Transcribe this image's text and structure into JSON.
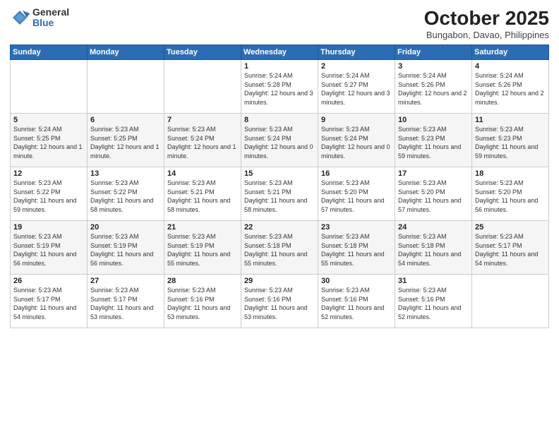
{
  "logo": {
    "general": "General",
    "blue": "Blue"
  },
  "header": {
    "month": "October 2025",
    "location": "Bungabon, Davao, Philippines"
  },
  "weekdays": [
    "Sunday",
    "Monday",
    "Tuesday",
    "Wednesday",
    "Thursday",
    "Friday",
    "Saturday"
  ],
  "weeks": [
    [
      {
        "day": "",
        "sunrise": "",
        "sunset": "",
        "daylight": ""
      },
      {
        "day": "",
        "sunrise": "",
        "sunset": "",
        "daylight": ""
      },
      {
        "day": "",
        "sunrise": "",
        "sunset": "",
        "daylight": ""
      },
      {
        "day": "1",
        "sunrise": "Sunrise: 5:24 AM",
        "sunset": "Sunset: 5:28 PM",
        "daylight": "Daylight: 12 hours and 3 minutes."
      },
      {
        "day": "2",
        "sunrise": "Sunrise: 5:24 AM",
        "sunset": "Sunset: 5:27 PM",
        "daylight": "Daylight: 12 hours and 3 minutes."
      },
      {
        "day": "3",
        "sunrise": "Sunrise: 5:24 AM",
        "sunset": "Sunset: 5:26 PM",
        "daylight": "Daylight: 12 hours and 2 minutes."
      },
      {
        "day": "4",
        "sunrise": "Sunrise: 5:24 AM",
        "sunset": "Sunset: 5:26 PM",
        "daylight": "Daylight: 12 hours and 2 minutes."
      }
    ],
    [
      {
        "day": "5",
        "sunrise": "Sunrise: 5:24 AM",
        "sunset": "Sunset: 5:25 PM",
        "daylight": "Daylight: 12 hours and 1 minute."
      },
      {
        "day": "6",
        "sunrise": "Sunrise: 5:23 AM",
        "sunset": "Sunset: 5:25 PM",
        "daylight": "Daylight: 12 hours and 1 minute."
      },
      {
        "day": "7",
        "sunrise": "Sunrise: 5:23 AM",
        "sunset": "Sunset: 5:24 PM",
        "daylight": "Daylight: 12 hours and 1 minute."
      },
      {
        "day": "8",
        "sunrise": "Sunrise: 5:23 AM",
        "sunset": "Sunset: 5:24 PM",
        "daylight": "Daylight: 12 hours and 0 minutes."
      },
      {
        "day": "9",
        "sunrise": "Sunrise: 5:23 AM",
        "sunset": "Sunset: 5:24 PM",
        "daylight": "Daylight: 12 hours and 0 minutes."
      },
      {
        "day": "10",
        "sunrise": "Sunrise: 5:23 AM",
        "sunset": "Sunset: 5:23 PM",
        "daylight": "Daylight: 11 hours and 59 minutes."
      },
      {
        "day": "11",
        "sunrise": "Sunrise: 5:23 AM",
        "sunset": "Sunset: 5:23 PM",
        "daylight": "Daylight: 11 hours and 59 minutes."
      }
    ],
    [
      {
        "day": "12",
        "sunrise": "Sunrise: 5:23 AM",
        "sunset": "Sunset: 5:22 PM",
        "daylight": "Daylight: 11 hours and 59 minutes."
      },
      {
        "day": "13",
        "sunrise": "Sunrise: 5:23 AM",
        "sunset": "Sunset: 5:22 PM",
        "daylight": "Daylight: 11 hours and 58 minutes."
      },
      {
        "day": "14",
        "sunrise": "Sunrise: 5:23 AM",
        "sunset": "Sunset: 5:21 PM",
        "daylight": "Daylight: 11 hours and 58 minutes."
      },
      {
        "day": "15",
        "sunrise": "Sunrise: 5:23 AM",
        "sunset": "Sunset: 5:21 PM",
        "daylight": "Daylight: 11 hours and 58 minutes."
      },
      {
        "day": "16",
        "sunrise": "Sunrise: 5:23 AM",
        "sunset": "Sunset: 5:20 PM",
        "daylight": "Daylight: 11 hours and 57 minutes."
      },
      {
        "day": "17",
        "sunrise": "Sunrise: 5:23 AM",
        "sunset": "Sunset: 5:20 PM",
        "daylight": "Daylight: 11 hours and 57 minutes."
      },
      {
        "day": "18",
        "sunrise": "Sunrise: 5:23 AM",
        "sunset": "Sunset: 5:20 PM",
        "daylight": "Daylight: 11 hours and 56 minutes."
      }
    ],
    [
      {
        "day": "19",
        "sunrise": "Sunrise: 5:23 AM",
        "sunset": "Sunset: 5:19 PM",
        "daylight": "Daylight: 11 hours and 56 minutes."
      },
      {
        "day": "20",
        "sunrise": "Sunrise: 5:23 AM",
        "sunset": "Sunset: 5:19 PM",
        "daylight": "Daylight: 11 hours and 56 minutes."
      },
      {
        "day": "21",
        "sunrise": "Sunrise: 5:23 AM",
        "sunset": "Sunset: 5:19 PM",
        "daylight": "Daylight: 11 hours and 55 minutes."
      },
      {
        "day": "22",
        "sunrise": "Sunrise: 5:23 AM",
        "sunset": "Sunset: 5:18 PM",
        "daylight": "Daylight: 11 hours and 55 minutes."
      },
      {
        "day": "23",
        "sunrise": "Sunrise: 5:23 AM",
        "sunset": "Sunset: 5:18 PM",
        "daylight": "Daylight: 11 hours and 55 minutes."
      },
      {
        "day": "24",
        "sunrise": "Sunrise: 5:23 AM",
        "sunset": "Sunset: 5:18 PM",
        "daylight": "Daylight: 11 hours and 54 minutes."
      },
      {
        "day": "25",
        "sunrise": "Sunrise: 5:23 AM",
        "sunset": "Sunset: 5:17 PM",
        "daylight": "Daylight: 11 hours and 54 minutes."
      }
    ],
    [
      {
        "day": "26",
        "sunrise": "Sunrise: 5:23 AM",
        "sunset": "Sunset: 5:17 PM",
        "daylight": "Daylight: 11 hours and 54 minutes."
      },
      {
        "day": "27",
        "sunrise": "Sunrise: 5:23 AM",
        "sunset": "Sunset: 5:17 PM",
        "daylight": "Daylight: 11 hours and 53 minutes."
      },
      {
        "day": "28",
        "sunrise": "Sunrise: 5:23 AM",
        "sunset": "Sunset: 5:16 PM",
        "daylight": "Daylight: 11 hours and 53 minutes."
      },
      {
        "day": "29",
        "sunrise": "Sunrise: 5:23 AM",
        "sunset": "Sunset: 5:16 PM",
        "daylight": "Daylight: 11 hours and 53 minutes."
      },
      {
        "day": "30",
        "sunrise": "Sunrise: 5:23 AM",
        "sunset": "Sunset: 5:16 PM",
        "daylight": "Daylight: 11 hours and 52 minutes."
      },
      {
        "day": "31",
        "sunrise": "Sunrise: 5:23 AM",
        "sunset": "Sunset: 5:16 PM",
        "daylight": "Daylight: 11 hours and 52 minutes."
      },
      {
        "day": "",
        "sunrise": "",
        "sunset": "",
        "daylight": ""
      }
    ]
  ]
}
